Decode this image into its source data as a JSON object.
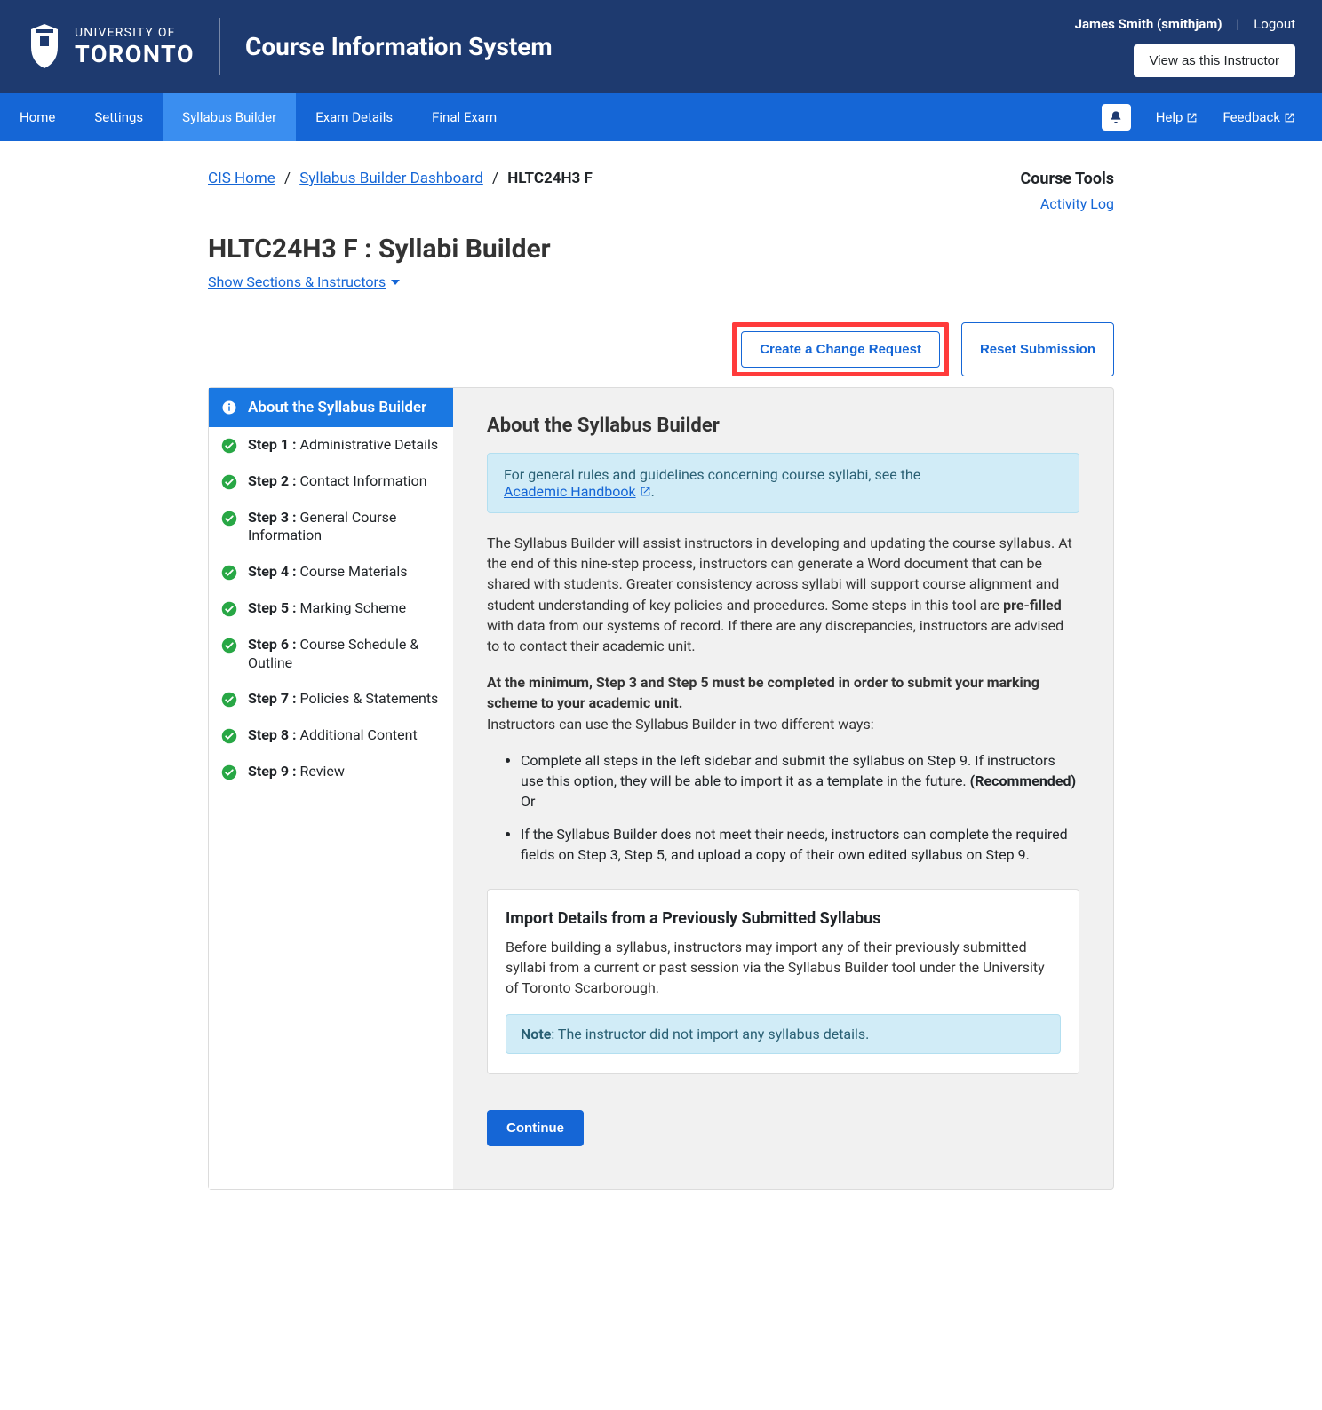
{
  "header": {
    "university_label": "UNIVERSITY OF",
    "university_name": "TORONTO",
    "app_title": "Course Information System",
    "user_display": "James Smith (smithjam)",
    "separator": "|",
    "logout": "Logout",
    "view_as_button": "View as this Instructor"
  },
  "nav": {
    "items": [
      "Home",
      "Settings",
      "Syllabus Builder",
      "Exam Details",
      "Final Exam"
    ],
    "help": "Help",
    "feedback": "Feedback"
  },
  "breadcrumb": {
    "home": "CIS Home",
    "dashboard": "Syllabus Builder Dashboard",
    "current": "HLTC24H3 F"
  },
  "course_tools": {
    "title": "Course Tools",
    "activity_log": "Activity Log"
  },
  "page": {
    "title": "HLTC24H3 F : Syllabi Builder",
    "show_sections": "Show Sections & Instructors"
  },
  "actions": {
    "change_request": "Create a Change Request",
    "reset": "Reset Submission"
  },
  "sidebar": {
    "header": "About the Syllabus Builder",
    "steps": [
      {
        "num": "Step 1 :",
        "label": " Administrative Details"
      },
      {
        "num": "Step 2 :",
        "label": " Contact Information"
      },
      {
        "num": "Step 3 :",
        "label": " General Course Information"
      },
      {
        "num": "Step 4 :",
        "label": " Course Materials"
      },
      {
        "num": "Step 5 :",
        "label": " Marking Scheme"
      },
      {
        "num": "Step 6 :",
        "label": " Course Schedule & Outline"
      },
      {
        "num": "Step 7 :",
        "label": " Policies & Statements"
      },
      {
        "num": "Step 8 :",
        "label": " Additional Content"
      },
      {
        "num": "Step 9 :",
        "label": " Review"
      }
    ]
  },
  "content": {
    "heading": "About the Syllabus Builder",
    "info_box_pre": "For general rules and guidelines concerning course syllabi, see the ",
    "info_box_link": "Academic Handbook",
    "info_box_post": ".",
    "para1_a": "The Syllabus Builder will assist instructors in developing and updating the course syllabus. At the end of this nine-step process, instructors can generate a Word document that can be shared with students. Greater consistency across syllabi will support course alignment and student understanding of key policies and procedures. Some steps in this tool are ",
    "para1_bold": "pre-filled",
    "para1_b": " with data from our systems of record. If there are any discrepancies, instructors are advised to to contact their academic unit.",
    "para2_bold": "At the minimum, Step 3 and Step 5 must be completed in order to submit your marking scheme to your academic unit.",
    "para2_rest": "Instructors can use the Syllabus Builder in two different ways:",
    "bullet1_a": "Complete all steps in the left sidebar and submit the syllabus on Step 9. If instructors use this option, they will be able to import it as a template in the future. ",
    "bullet1_bold": "(Recommended)",
    "bullet1_or": "Or",
    "bullet2": "If the Syllabus Builder does not meet their needs, instructors can complete the required fields on Step 3, Step 5, and upload a copy of their own edited syllabus on Step 9.",
    "import": {
      "title": "Import Details from a Previously Submitted Syllabus",
      "desc": "Before building a syllabus, instructors may import any of their previously submitted syllabi from a current or past session via the Syllabus Builder tool under the University of Toronto Scarborough.",
      "note_label": "Note",
      "note_text": ": The instructor did not import any syllabus details."
    },
    "continue": "Continue"
  }
}
